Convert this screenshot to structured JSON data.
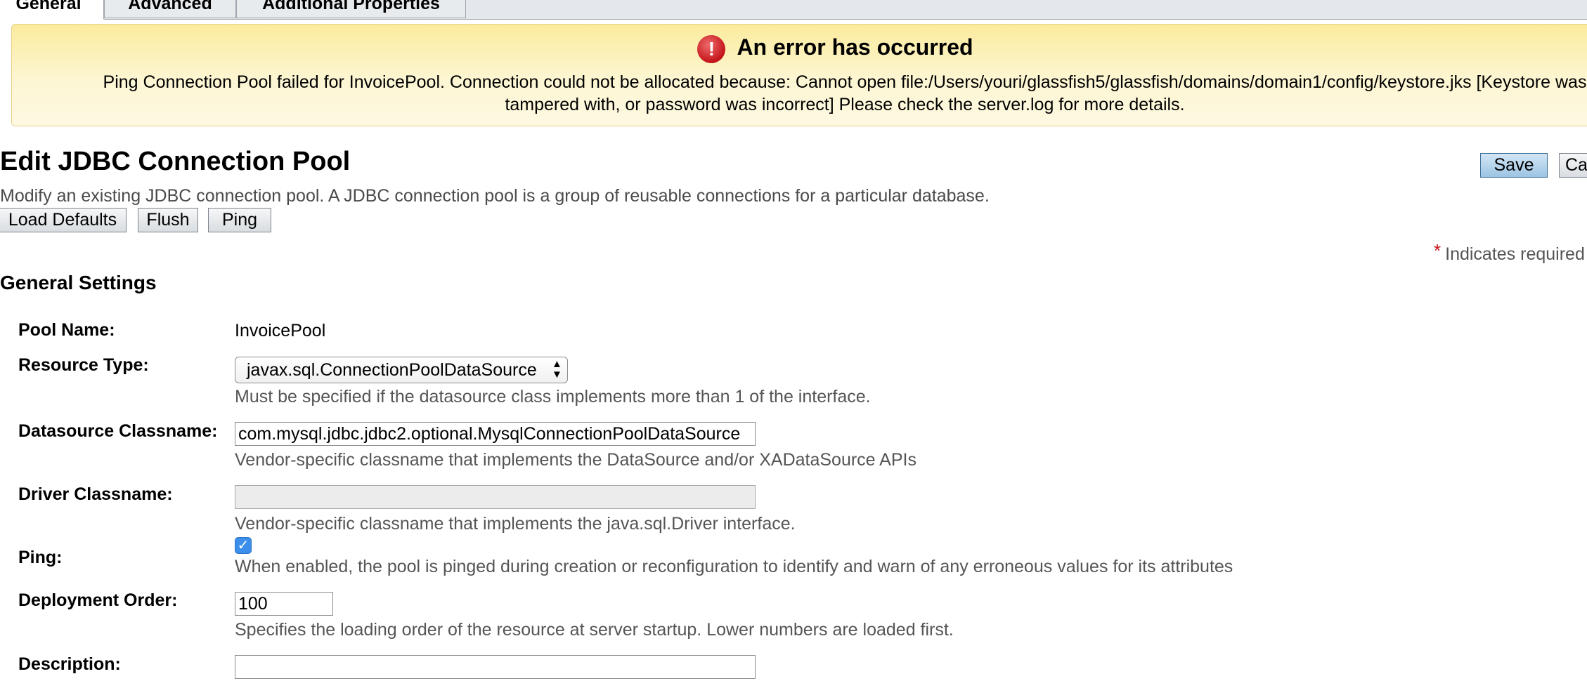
{
  "tabs": [
    {
      "label": "General"
    },
    {
      "label": "Advanced"
    },
    {
      "label": "Additional Properties"
    }
  ],
  "alert": {
    "title": "An error has occurred",
    "icon": "exclamation-icon",
    "line1": "Ping Connection Pool failed for InvoicePool. Connection could not be allocated because: Cannot open file:/Users/youri/glassfish5/glassfish/domains/domain1/config/keystore.jks [Keystore was",
    "line2": "tampered with, or password was incorrect] Please check the server.log for more details."
  },
  "page": {
    "title": "Edit JDBC Connection Pool",
    "help": "Modify an existing JDBC connection pool. A JDBC connection pool is a group of reusable connections for a particular database.",
    "save_label": "Save",
    "cancel_label": "Ca",
    "load_defaults_label": "Load Defaults",
    "flush_label": "Flush",
    "ping_label": "Ping",
    "required_star": "*",
    "required_text": "Indicates required"
  },
  "general": {
    "section_title": "General Settings",
    "pool_name": {
      "label": "Pool Name:",
      "value": "InvoicePool"
    },
    "resource_type": {
      "label": "Resource Type:",
      "value": "javax.sql.ConnectionPoolDataSource",
      "help": "Must be specified if the datasource class implements more than 1 of the interface."
    },
    "datasource_classname": {
      "label": "Datasource Classname:",
      "value": "com.mysql.jdbc.jdbc2.optional.MysqlConnectionPoolDataSource",
      "help": "Vendor-specific classname that implements the DataSource and/or XADataSource APIs"
    },
    "driver_classname": {
      "label": "Driver Classname:",
      "value": "",
      "help": "Vendor-specific classname that implements the java.sql.Driver interface."
    },
    "ping": {
      "label": "Ping:",
      "checked": true,
      "check_glyph": "✓",
      "help": "When enabled, the pool is pinged during creation or reconfiguration to identify and warn of any erroneous values for its attributes"
    },
    "deployment_order": {
      "label": "Deployment Order:",
      "value": "100",
      "help": "Specifies the loading order of the resource at server startup. Lower numbers are loaded first."
    },
    "description": {
      "label": "Description:",
      "value": ""
    }
  },
  "colors": {
    "alert_bg": "#fbeb9d",
    "error_red": "#c3141a",
    "primary_button": "#9cc4e3",
    "checkbox_blue": "#3b8eea"
  }
}
